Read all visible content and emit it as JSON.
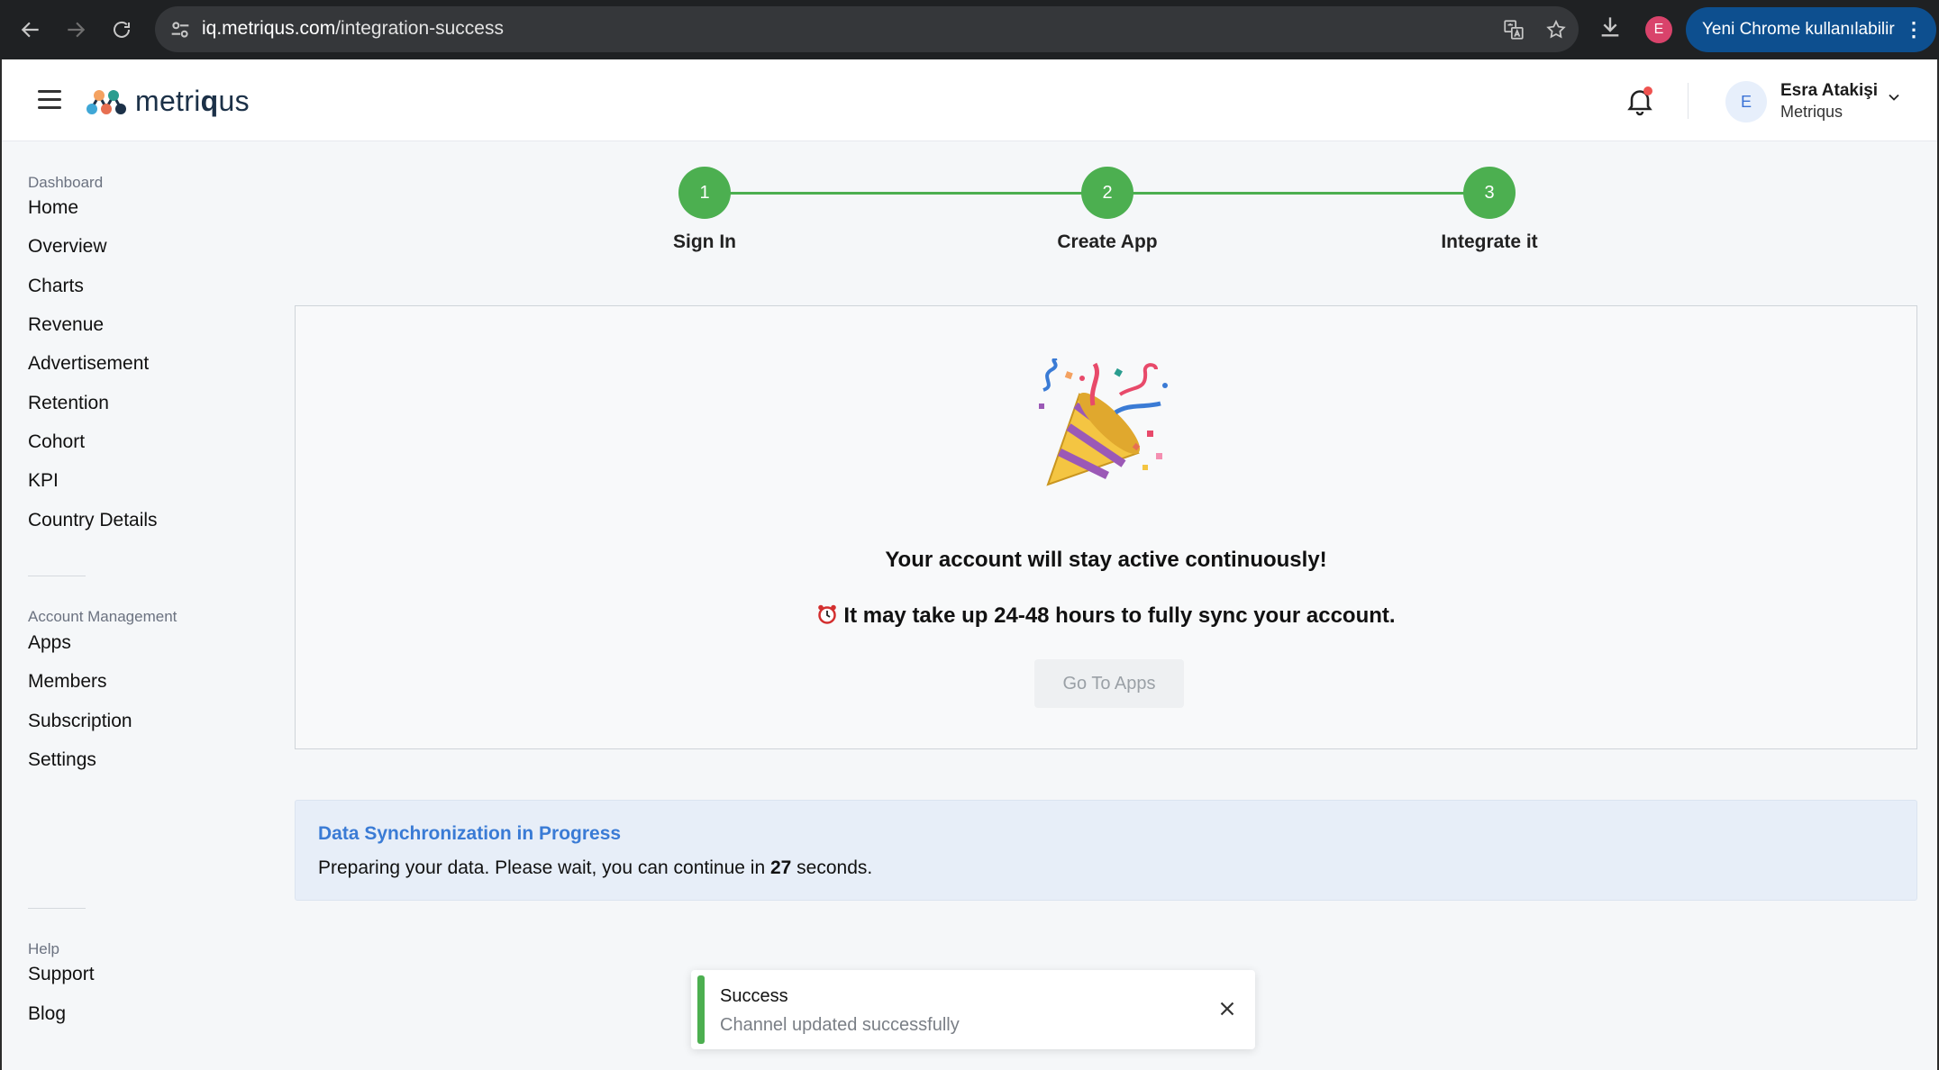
{
  "browser": {
    "url_host": "iq.metriqus.com",
    "url_path": "/integration-success",
    "profile_initial": "E",
    "update_label": "Yeni Chrome kullanılabilir"
  },
  "header": {
    "logo_prefix": "metri",
    "logo_bold": "q",
    "logo_suffix": "us",
    "user_initial": "E",
    "user_name": "Esra Atakişi",
    "user_org": "Metriqus"
  },
  "sidebar": {
    "sections": [
      {
        "title": "Dashboard",
        "items": [
          "Home",
          "Overview",
          "Charts",
          "Revenue",
          "Advertisement",
          "Retention",
          "Cohort",
          "KPI",
          "Country Details"
        ]
      },
      {
        "title": "Account Management",
        "items": [
          "Apps",
          "Members",
          "Subscription",
          "Settings"
        ]
      },
      {
        "title": "Help",
        "items": [
          "Support",
          "Blog"
        ]
      }
    ]
  },
  "stepper": {
    "steps": [
      {
        "number": "1",
        "label": "Sign In"
      },
      {
        "number": "2",
        "label": "Create App"
      },
      {
        "number": "3",
        "label": "Integrate it"
      }
    ]
  },
  "card": {
    "headline": "Your account will stay active continuously!",
    "subline": "It may take up 24-48 hours to fully sync your account.",
    "button_label": "Go To Apps"
  },
  "sync": {
    "title": "Data Synchronization in Progress",
    "text_before": "Preparing your data. Please wait, you can continue in ",
    "seconds": "27",
    "text_after": " seconds."
  },
  "toast": {
    "title": "Success",
    "message": "Channel updated successfully"
  },
  "colors": {
    "accent_green": "#4caf50",
    "info_blue": "#3a7bd5",
    "chrome_update": "#0d4f8f"
  }
}
